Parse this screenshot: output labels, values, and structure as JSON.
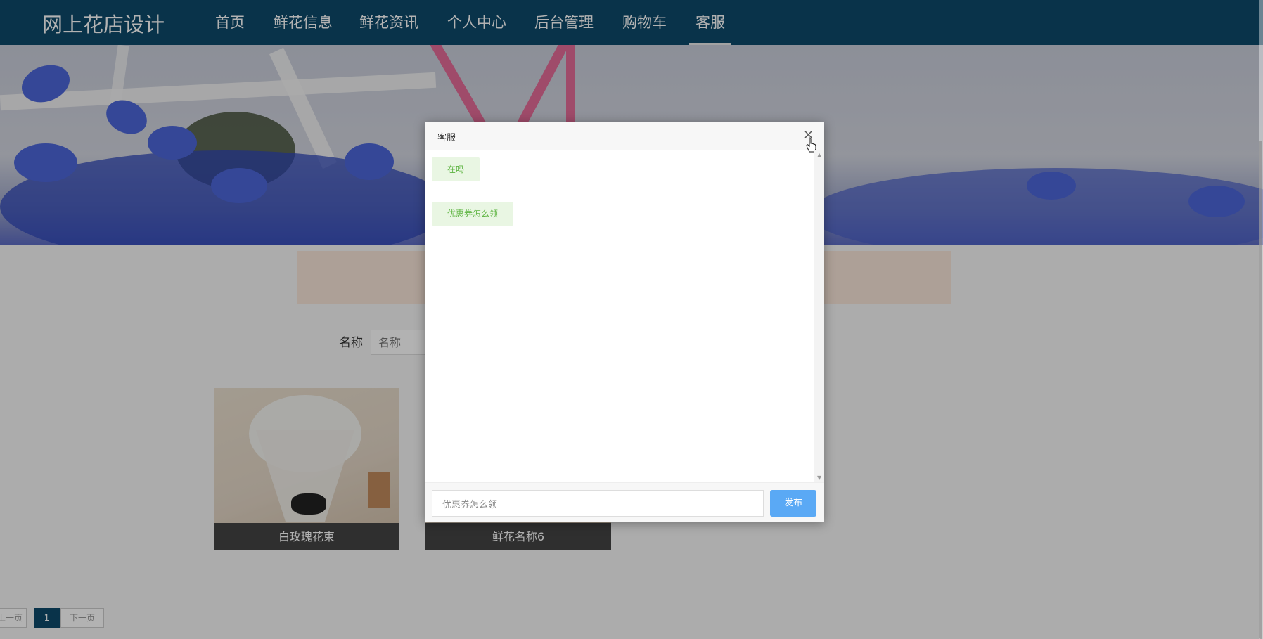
{
  "nav": {
    "logo": "网上花店设计",
    "items": [
      {
        "label": "首页"
      },
      {
        "label": "鲜花信息"
      },
      {
        "label": "鲜花资讯"
      },
      {
        "label": "个人中心"
      },
      {
        "label": "后台管理"
      },
      {
        "label": "购物车"
      },
      {
        "label": "客服",
        "active": true
      }
    ]
  },
  "search": {
    "label": "名称",
    "placeholder": "名称"
  },
  "cards": [
    {
      "label": "白玫瑰花束"
    },
    {
      "label": "鲜花名称6"
    }
  ],
  "pager": {
    "prev": "上一页",
    "current": "1",
    "next": "下一页"
  },
  "dialog": {
    "title": "客服",
    "close": "×",
    "messages": [
      {
        "text": "在吗"
      },
      {
        "text": "优惠券怎么领"
      }
    ],
    "compose_value": "优惠券怎么领",
    "send_label": "发布"
  },
  "colors": {
    "nav_bg": "#0e4a6a",
    "bubble_bg": "#e9f6e3",
    "bubble_text": "#5fb543",
    "send_button": "#5aa9f5"
  }
}
